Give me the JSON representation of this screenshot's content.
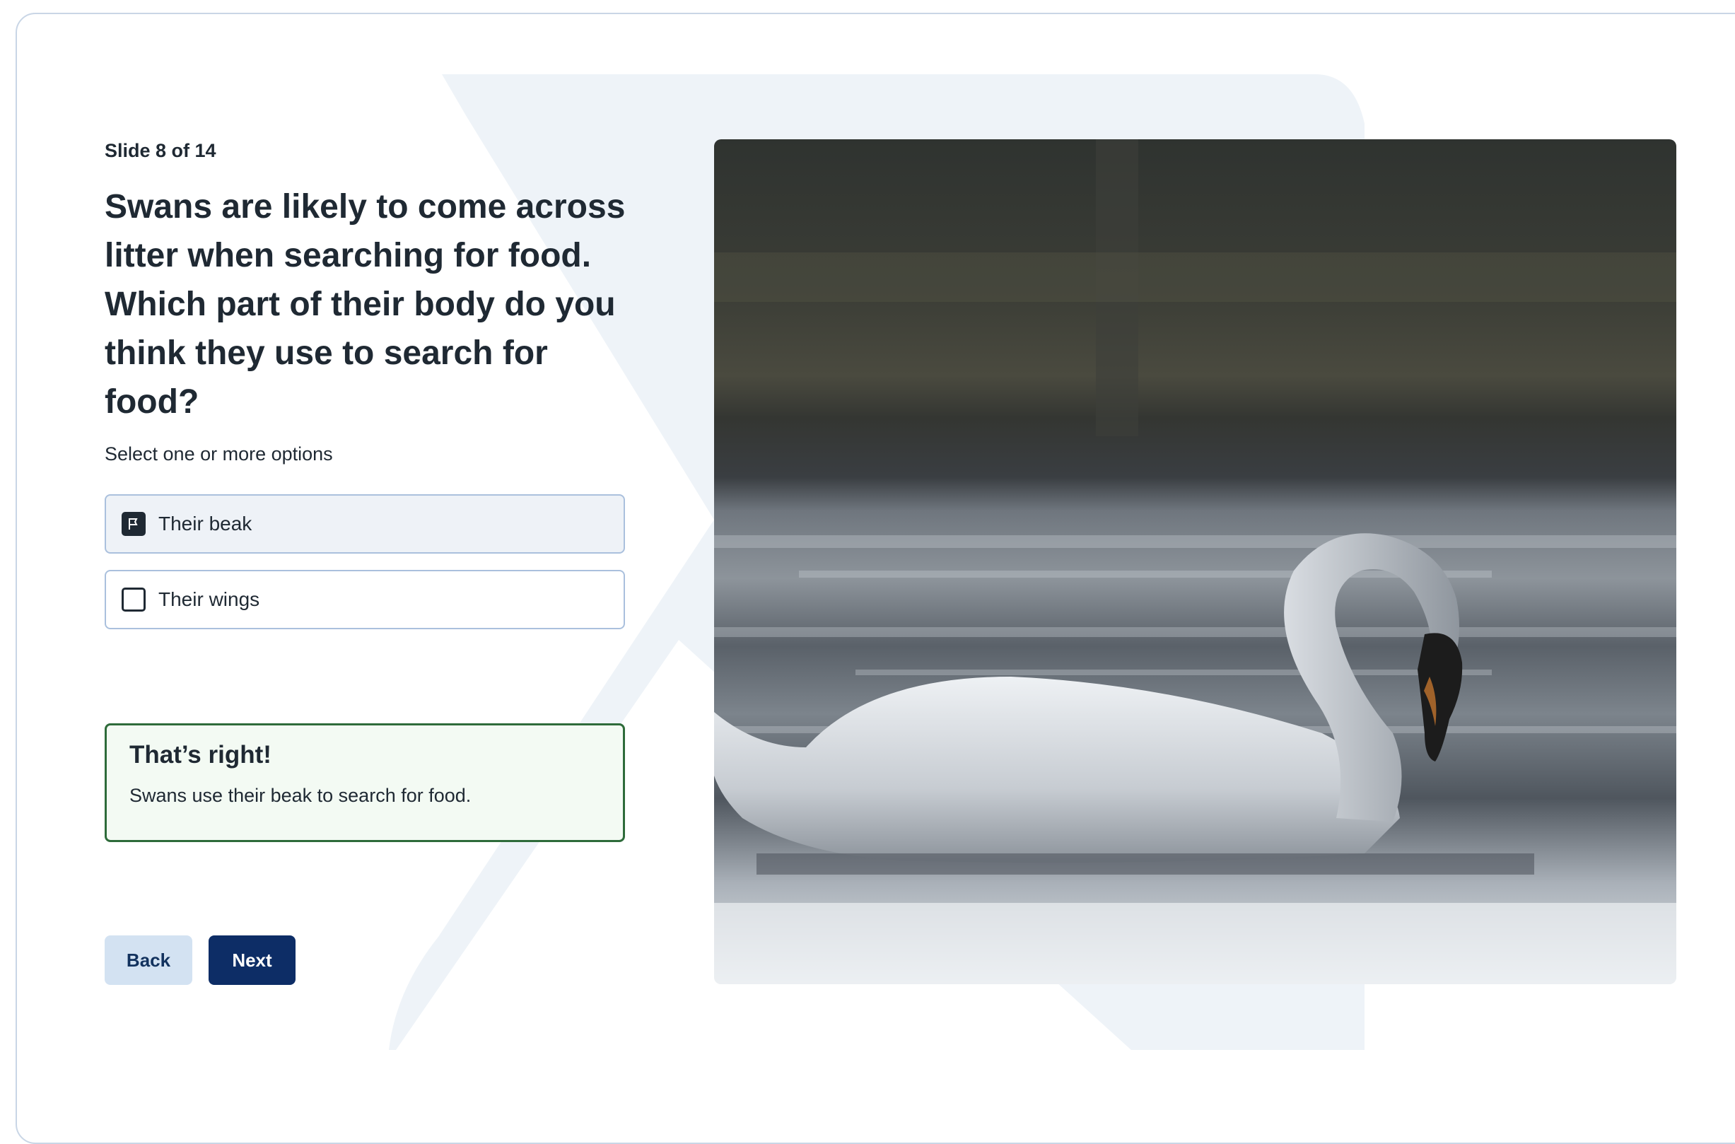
{
  "slide": {
    "counter": "Slide 8 of 14"
  },
  "question": {
    "text": "Swans are likely to come across litter when searching for food. Which part of their body do you think they use to search for food?",
    "hint": "Select one or more options"
  },
  "options": [
    {
      "label": "Their beak",
      "checked": true
    },
    {
      "label": "Their wings",
      "checked": false
    }
  ],
  "feedback": {
    "title": "That’s right!",
    "body": "Swans use their beak to search for food."
  },
  "buttons": {
    "back": "Back",
    "next": "Next"
  },
  "colors": {
    "primary": "#0d2d66",
    "secondary": "#d3e2f2",
    "success_border": "#2e6b3a",
    "success_bg": "#f3faf3",
    "option_border": "#aac0dd"
  },
  "icons": {
    "checked": "flag-icon",
    "unchecked": "checkbox-empty-icon"
  },
  "image": {
    "subject": "swan-photo"
  }
}
